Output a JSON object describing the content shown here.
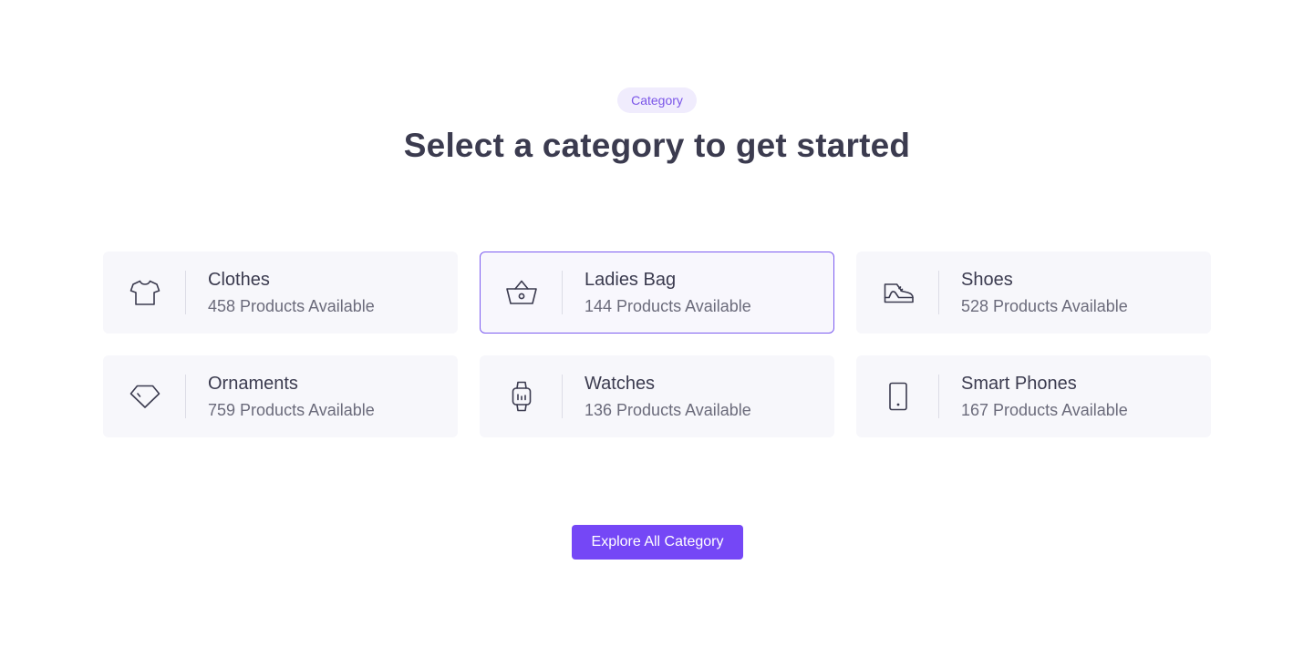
{
  "header": {
    "badge": "Category",
    "title": "Select a category to get started"
  },
  "categories": [
    {
      "name": "Clothes",
      "count": "458 Products Available",
      "icon": "tshirt-icon",
      "selected": false
    },
    {
      "name": "Ladies Bag",
      "count": "144 Products Available",
      "icon": "basket-icon",
      "selected": true
    },
    {
      "name": "Shoes",
      "count": "528 Products Available",
      "icon": "shoe-icon",
      "selected": false
    },
    {
      "name": "Ornaments",
      "count": "759 Products Available",
      "icon": "diamond-icon",
      "selected": false
    },
    {
      "name": "Watches",
      "count": "136 Products Available",
      "icon": "watch-icon",
      "selected": false
    },
    {
      "name": "Smart Phones",
      "count": "167 Products Available",
      "icon": "smartphone-icon",
      "selected": false
    }
  ],
  "cta": {
    "label": "Explore All Category"
  },
  "colors": {
    "accent": "#7547f6",
    "selected_border": "#7c5cf0",
    "card_background": "#f7f7fb",
    "heading": "#3b3b4f"
  }
}
